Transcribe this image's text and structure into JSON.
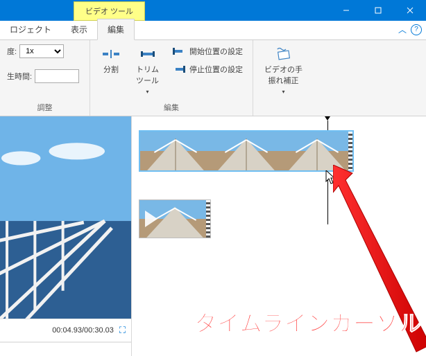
{
  "window": {
    "context_tab": "ビデオ ツール"
  },
  "tabs": {
    "project": "ロジェクト",
    "view": "表示",
    "edit": "編集"
  },
  "ribbon": {
    "group_adjust": {
      "speed_label": "度:",
      "speed_value": "1x",
      "playtime_label": "生時間:",
      "playtime_value": "",
      "title": "調整"
    },
    "group_edit": {
      "split": "分割",
      "trim": "トリム\nツール",
      "set_start": "開始位置の設定",
      "set_end": "停止位置の設定",
      "title": "編集"
    },
    "group_stabilize": {
      "label": "ビデオの手\n振れ補正"
    }
  },
  "preview": {
    "time": "00:04.93/00:30.03"
  },
  "annotation": {
    "text": "タイムラインカーソル"
  },
  "chart_data": null
}
